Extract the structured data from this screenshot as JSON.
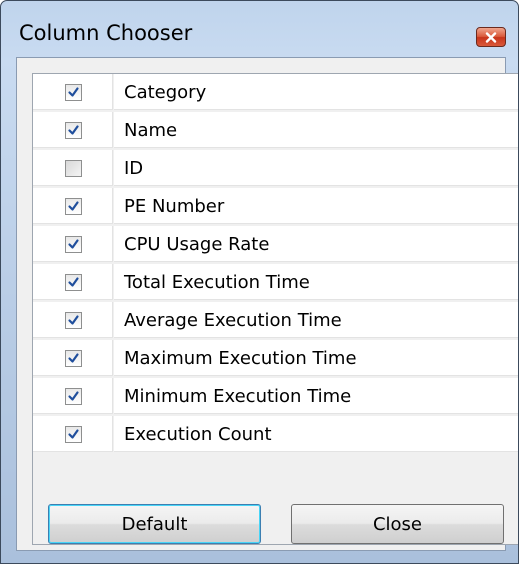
{
  "window": {
    "title": "Column Chooser"
  },
  "columns": [
    {
      "label": "Category",
      "checked": true
    },
    {
      "label": "Name",
      "checked": true
    },
    {
      "label": "ID",
      "checked": false
    },
    {
      "label": "PE Number",
      "checked": true
    },
    {
      "label": "CPU Usage Rate",
      "checked": true
    },
    {
      "label": "Total Execution Time",
      "checked": true
    },
    {
      "label": "Average Execution Time",
      "checked": true
    },
    {
      "label": "Maximum Execution Time",
      "checked": true
    },
    {
      "label": "Minimum Execution Time",
      "checked": true
    },
    {
      "label": "Execution Count",
      "checked": true
    }
  ],
  "buttons": {
    "default_label": "Default",
    "close_label": "Close"
  },
  "colors": {
    "check_mark": "#1f4e9c",
    "close_button": "#c7341a"
  },
  "icons": {
    "close": "close-icon",
    "check": "checkmark-icon"
  }
}
